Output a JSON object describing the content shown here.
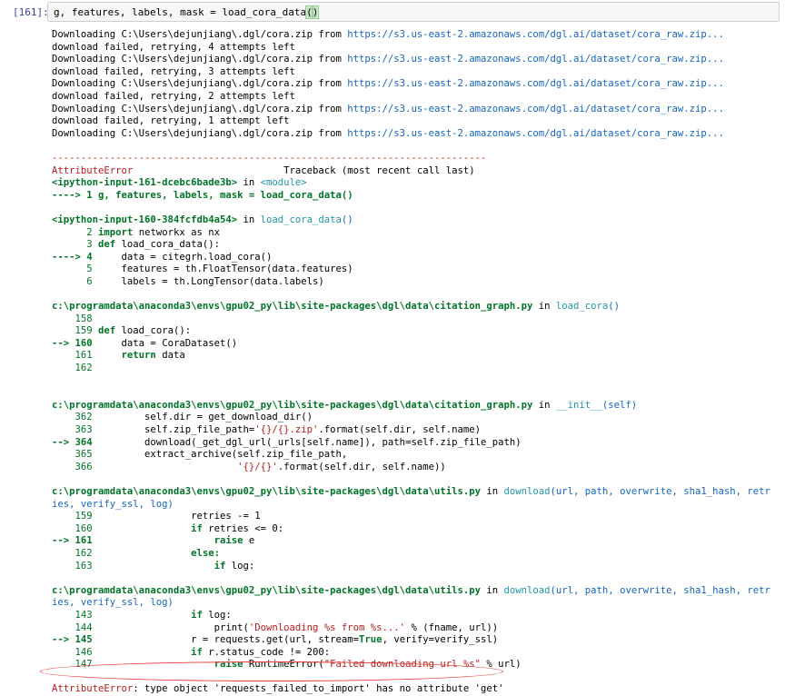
{
  "cell": {
    "prompt": "[161]:",
    "code_prefix": "g, features, labels, mask = load_cora_data",
    "code_paren_open": "(",
    "code_paren_close": ")"
  },
  "download_lines": [
    {
      "prefix": "Downloading C:\\Users\\dejunjiang\\.dgl/cora.zip from ",
      "url": "https://s3.us-east-2.amazonaws.com/dgl.ai/dataset/cora_raw.zip..."
    },
    {
      "text": "download failed, retrying, 4 attempts left"
    },
    {
      "prefix": "Downloading C:\\Users\\dejunjiang\\.dgl/cora.zip from ",
      "url": "https://s3.us-east-2.amazonaws.com/dgl.ai/dataset/cora_raw.zip..."
    },
    {
      "text": "download failed, retrying, 3 attempts left"
    },
    {
      "prefix": "Downloading C:\\Users\\dejunjiang\\.dgl/cora.zip from ",
      "url": "https://s3.us-east-2.amazonaws.com/dgl.ai/dataset/cora_raw.zip..."
    },
    {
      "text": "download failed, retrying, 2 attempts left"
    },
    {
      "prefix": "Downloading C:\\Users\\dejunjiang\\.dgl/cora.zip from ",
      "url": "https://s3.us-east-2.amazonaws.com/dgl.ai/dataset/cora_raw.zip..."
    },
    {
      "text": "download failed, retrying, 1 attempt left"
    },
    {
      "prefix": "Downloading C:\\Users\\dejunjiang\\.dgl/cora.zip from ",
      "url": "https://s3.us-east-2.amazonaws.com/dgl.ai/dataset/cora_raw.zip..."
    }
  ],
  "traceback": {
    "separator": "---------------------------------------------------------------------------",
    "error_name": "AttributeError",
    "header_right": "                          Traceback (most recent call last)",
    "frame1_file": "<ipython-input-161-dcebc6bade3b>",
    "frame1_in": " in ",
    "frame1_func": "<module>",
    "frame1_line": "----> 1 g, features, labels, mask = load_cora_data()",
    "frame2_file": "<ipython-input-160-384fcfdb4a54>",
    "frame2_in": " in ",
    "frame2_func": "load_cora_data",
    "frame2_paren": "()",
    "frame2_l2_no": "      2 ",
    "frame2_l2_kw": "import",
    "frame2_l2_rest": " networkx as nx",
    "frame2_l3_no": "      3 ",
    "frame2_l3_kw": "def",
    "frame2_l3_rest": " load_cora_data():",
    "frame2_l4_arrow": "----> 4 ",
    "frame2_l4_rest": "    data = citegrh.load_cora()",
    "frame2_l5_no": "      5 ",
    "frame2_l5_rest": "    features = th.FloatTensor(data.features)",
    "frame2_l6_no": "      6 ",
    "frame2_l6_rest": "    labels = th.LongTensor(data.labels)",
    "frame3_path": "c:\\programdata\\anaconda3\\envs\\gpu02_py\\lib\\site-packages\\dgl\\data\\citation_graph.py",
    "frame3_in": " in ",
    "frame3_func": "load_cora",
    "frame3_paren": "()",
    "frame3_l158": "    158 ",
    "frame3_l159_no": "    159 ",
    "frame3_l159_kw": "def",
    "frame3_l159_rest": " load_cora():",
    "frame3_l160_arrow": "--> 160 ",
    "frame3_l160_rest": "    data = CoraDataset()",
    "frame3_l161_no": "    161 ",
    "frame3_l161_kw": "    return",
    "frame3_l161_rest": " data",
    "frame3_l162": "    162 ",
    "frame4_path": "c:\\programdata\\anaconda3\\envs\\gpu02_py\\lib\\site-packages\\dgl\\data\\citation_graph.py",
    "frame4_in": " in ",
    "frame4_func": "__init__",
    "frame4_paren": "(self)",
    "frame4_l362_no": "    362 ",
    "frame4_l362_rest": "        self.dir = get_download_dir()",
    "frame4_l363_no": "    363 ",
    "frame4_l363_a": "        self.zip_file_path=",
    "frame4_l363_str": "'{}/{}.zip'",
    "frame4_l363_b": ".format(self.dir, self.name)",
    "frame4_l364_arrow": "--> 364 ",
    "frame4_l364_rest": "        download(_get_dgl_url(_urls[self.name]), path=self.zip_file_path)",
    "frame4_l365_no": "    365 ",
    "frame4_l365_rest": "        extract_archive(self.zip_file_path,",
    "frame4_l366_no": "    366 ",
    "frame4_l366_a": "                        ",
    "frame4_l366_str": "'{}/{}'",
    "frame4_l366_b": ".format(self.dir, self.name))",
    "frame5_path": "c:\\programdata\\anaconda3\\envs\\gpu02_py\\lib\\site-packages\\dgl\\data\\utils.py",
    "frame5_in": " in ",
    "frame5_func": "download",
    "frame5_args1": "(url, path, overwrite, sha1_hash, retr",
    "frame5_args2": "ies, verify_ssl, log)",
    "frame5_l159_no": "    159 ",
    "frame5_l159_rest": "                retries -= 1",
    "frame5_l160_no": "    160 ",
    "frame5_l160_kw": "                if",
    "frame5_l160_rest": " retries <= 0:",
    "frame5_l161_arrow": "--> 161 ",
    "frame5_l161_kw": "                    raise",
    "frame5_l161_rest": " e",
    "frame5_l162_no": "    162 ",
    "frame5_l162_kw": "                else:",
    "frame5_l163_no": "    163 ",
    "frame5_l163_kw": "                    if",
    "frame5_l163_rest": " log:",
    "frame6_path": "c:\\programdata\\anaconda3\\envs\\gpu02_py\\lib\\site-packages\\dgl\\data\\utils.py",
    "frame6_in": " in ",
    "frame6_func": "download",
    "frame6_args1": "(url, path, overwrite, sha1_hash, retr",
    "frame6_args2": "ies, verify_ssl, log)",
    "frame6_l143_no": "    143 ",
    "frame6_l143_kw": "                if",
    "frame6_l143_rest": " log:",
    "frame6_l144_no": "    144 ",
    "frame6_l144_a": "                    print(",
    "frame6_l144_str": "'Downloading %s from %s...'",
    "frame6_l144_b": " % (fname, url))",
    "frame6_l145_arrow": "--> 145 ",
    "frame6_l145_a": "                r = requests.get(url, stream=",
    "frame6_l145_kw": "True",
    "frame6_l145_b": ", verify=verify_ssl)",
    "frame6_l146_no": "    146 ",
    "frame6_l146_kw": "                if",
    "frame6_l146_rest": " r.status_code != 200:",
    "frame6_l147_no": "    147 ",
    "frame6_l147_kw": "                    raise",
    "frame6_l147_a": " RuntimeError(",
    "frame6_l147_str": "\"Failed downloading url %s\"",
    "frame6_l147_b": " % url)",
    "final_error_name": "AttributeError",
    "final_error_msg": ": type object 'requests_failed_to_import' has no attribute 'get'"
  },
  "colors": {
    "prompt": "#303f9f",
    "url": "#1565c0",
    "error": "#b71c1c",
    "green": "#007427",
    "annotation_ellipse": "#e53935"
  }
}
